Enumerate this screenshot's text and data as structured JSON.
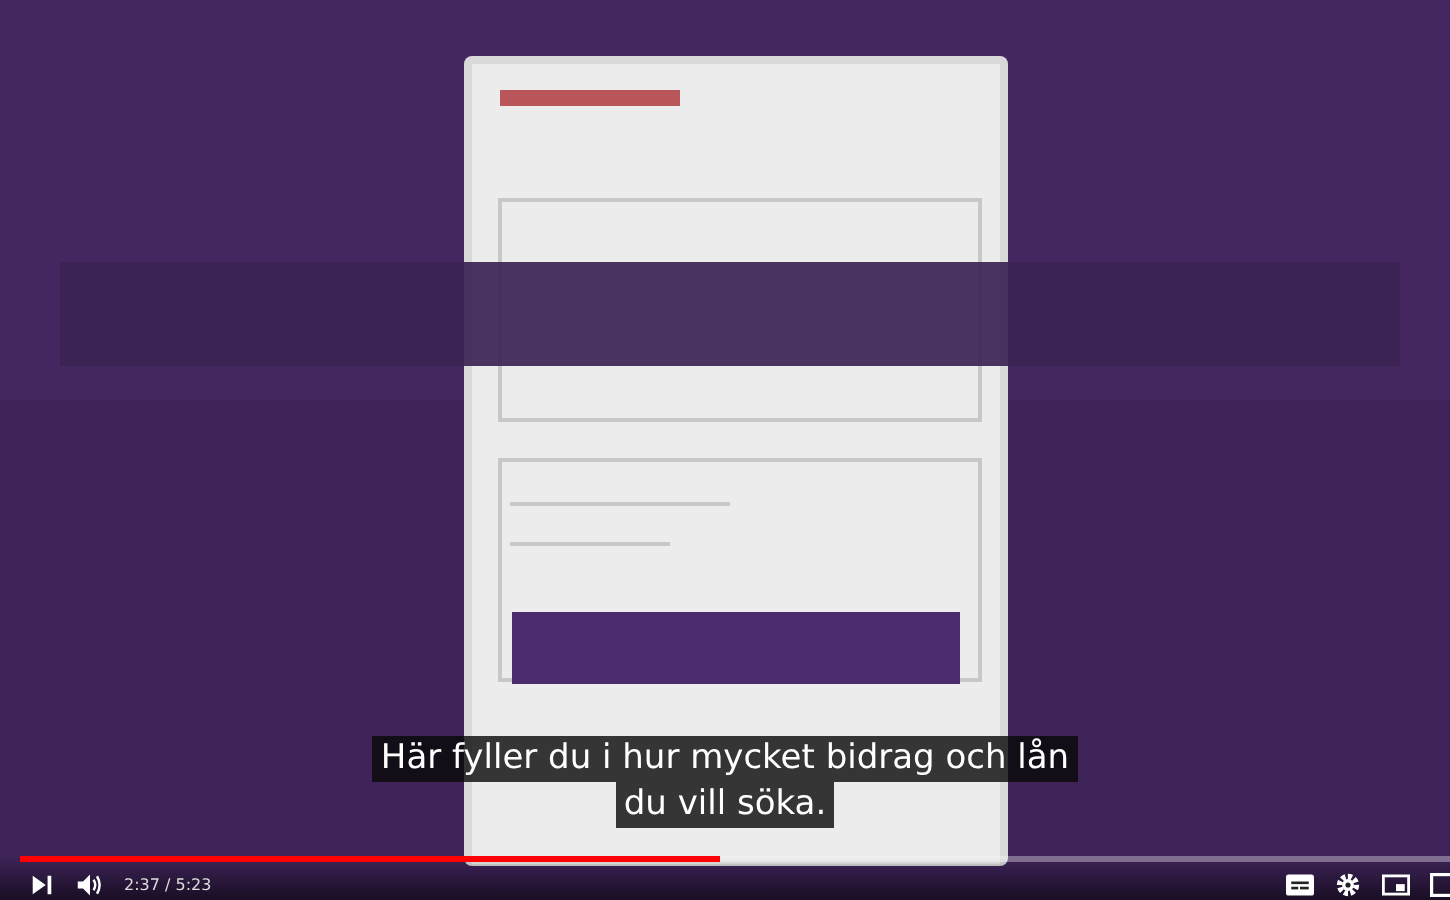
{
  "captions": [
    "Här fyller du i hur mycket bidrag och lån",
    "du vill söka."
  ],
  "controls": {
    "progress": {
      "level": 0.49
    },
    "time": "2:37 / 5:23",
    "subtitles_on": true
  }
}
